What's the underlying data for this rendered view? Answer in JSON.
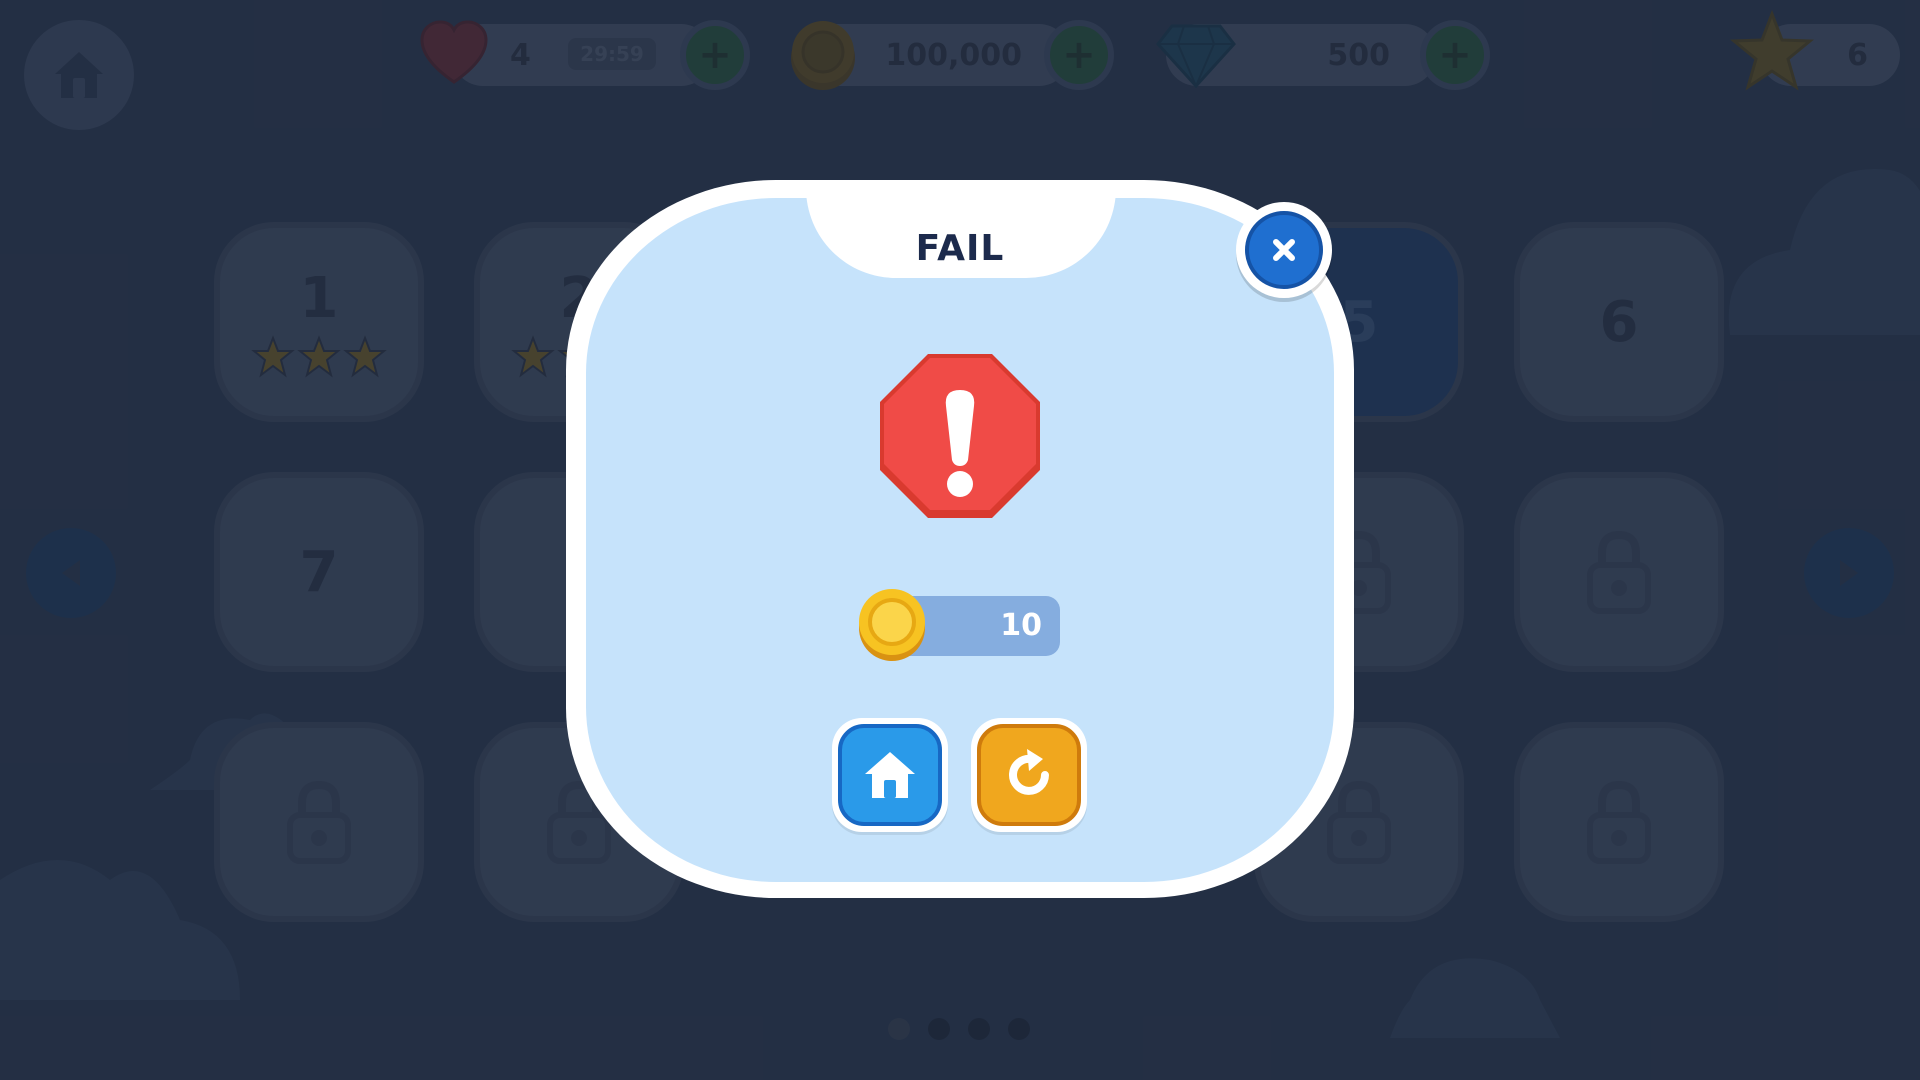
{
  "hud": {
    "lives": "4",
    "timer": "29:59",
    "coins": "100,000",
    "gems": "500",
    "stars": "6"
  },
  "levels": [
    {
      "label": "1",
      "stars": 3,
      "locked": false
    },
    {
      "label": "2",
      "stars": 3,
      "locked": false
    },
    {
      "label": "5",
      "stars": 0,
      "locked": false,
      "current": true
    },
    {
      "label": "6",
      "stars": 0,
      "locked": false
    },
    {
      "label": "7",
      "stars": 0,
      "locked": false
    },
    {
      "label": "",
      "stars": 0,
      "locked": true
    }
  ],
  "pagination": {
    "pages": 4,
    "active": 0
  },
  "modal": {
    "title": "FAIL",
    "reward": "10"
  },
  "colors": {
    "background": "#2b3a52",
    "modal_fill": "#c6e3fb",
    "warning_red": "#f04b47",
    "home_blue": "#2a9ae9",
    "retry_orange": "#f0a71e",
    "coin_gold": "#f7c322"
  },
  "icons": {
    "close": "x-icon",
    "warning": "warning-octagon-icon",
    "home": "home-icon",
    "retry": "retry-icon",
    "coin": "coin-icon"
  }
}
